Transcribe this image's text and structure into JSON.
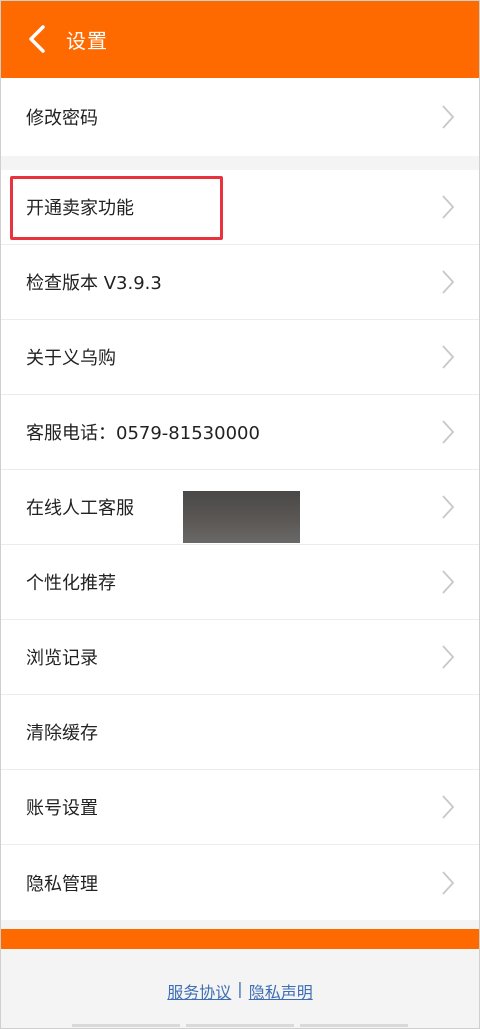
{
  "header": {
    "title": "设置",
    "back_icon": "chevron-left-icon"
  },
  "groups": [
    {
      "items": [
        {
          "label": "修改密码"
        }
      ]
    },
    {
      "items": [
        {
          "label": "开通卖家功能"
        },
        {
          "label": "检查版本 V3.9.3"
        },
        {
          "label": "关于义乌购"
        },
        {
          "label": "客服电话：0579-81530000"
        },
        {
          "label": "在线人工客服"
        },
        {
          "label": "个性化推荐"
        },
        {
          "label": "浏览记录"
        },
        {
          "label": "清除缓存"
        },
        {
          "label": "账号设置"
        },
        {
          "label": "隐私管理"
        }
      ]
    }
  ],
  "footer": {
    "service_agreement": "服务协议",
    "separator": "|",
    "privacy_statement": "隐私声明"
  },
  "colors": {
    "brand": "#ff6a00",
    "highlight": "#e8333e",
    "link": "#3e6fb4"
  }
}
